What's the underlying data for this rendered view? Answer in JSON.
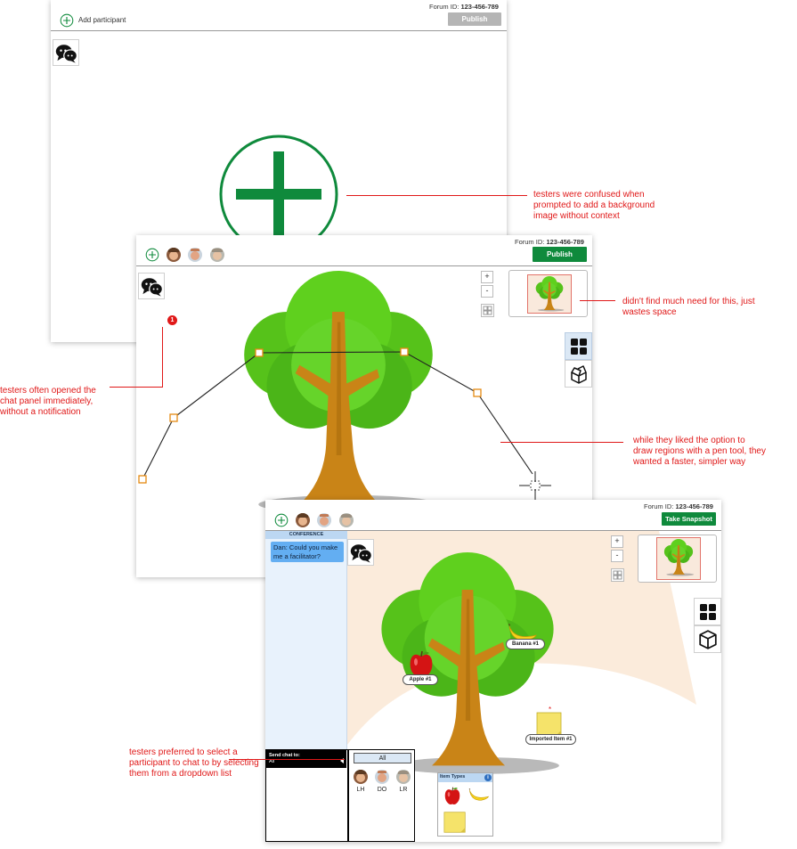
{
  "forum": {
    "prefix": "Forum ID:",
    "id": "123-456-789"
  },
  "screen1": {
    "add_participant_label": "Add participant",
    "publish_label": "Publish"
  },
  "screen2": {
    "publish_label": "Publish",
    "zoom_in": "+",
    "zoom_out": "-",
    "notification_count": "1"
  },
  "screen3": {
    "snapshot_label": "Take Snapshot",
    "conference_header": "CONFERENCE",
    "chat_message": "Dan: Could you make me a facilitator?",
    "zoom_in": "+",
    "zoom_out": "-",
    "item_labels": {
      "apple": "Apple #1",
      "banana": "Banana #1",
      "imported": "Imported Item #1"
    },
    "send_chat_to": {
      "title": "Send chat to:",
      "value": "All"
    },
    "recipients": {
      "all_button": "All",
      "participants": [
        "LH",
        "DO",
        "LR"
      ]
    },
    "item_types_title": "Item Types"
  },
  "annotations": [
    "testers were confused when prompted to add a background image without context",
    "didn't find much need for this, just wastes space",
    "testers often opened the chat panel immediately, without a notification",
    "while they liked the option to draw regions with a pen tool, they wanted a faster, simpler way",
    "testers preferred to select a participant to chat to by selecting them from a dropdown list"
  ],
  "colors": {
    "brand_green": "#0f8a3c",
    "annotation_red": "#e01818",
    "chat_bubble": "#63aef2",
    "conference_bg": "#e8f2fc",
    "canvas_shade": "#fbebdb"
  }
}
